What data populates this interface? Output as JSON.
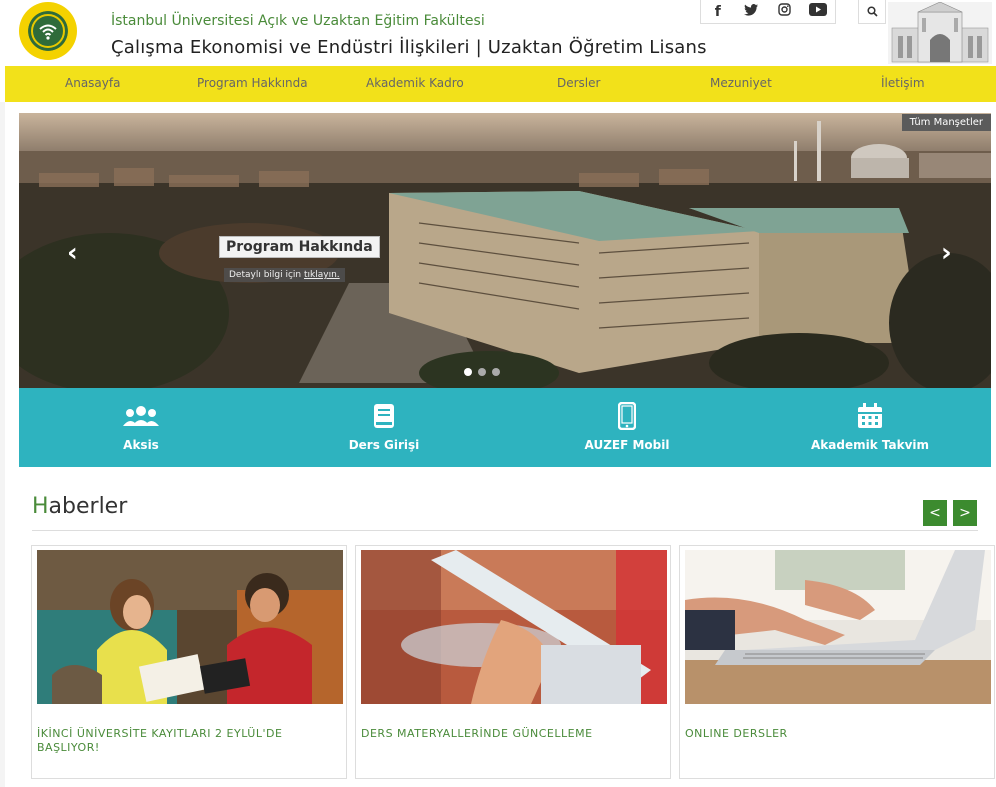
{
  "header": {
    "faculty": "İstanbul Üniversitesi Açık ve Uzaktan Eğitim Fakültesi",
    "program": "Çalışma Ekonomisi ve Endüstri İlişkileri | Uzaktan Öğretim Lisans",
    "socials": [
      {
        "icon": "facebook-icon",
        "glyph": "f"
      },
      {
        "icon": "twitter-icon",
        "glyph": "🐦"
      },
      {
        "icon": "instagram-icon",
        "glyph": "◎"
      },
      {
        "icon": "youtube-icon",
        "glyph": "▶"
      }
    ],
    "search_glyph": "🔍"
  },
  "nav": {
    "items": [
      "Anasayfa",
      "Program Hakkında",
      "Akademik Kadro",
      "Dersler",
      "Mezuniyet",
      "İletişim"
    ]
  },
  "hero": {
    "all_headlines": "Tüm Manşetler",
    "caption_title": "Program Hakkında",
    "caption_sub_prefix": "Detaylı bilgi için",
    "caption_sub_link": "tıklayın.",
    "prev": "‹",
    "next": "›",
    "slide_count": 3,
    "active_slide": 1
  },
  "quick_links": [
    {
      "label": "Aksis",
      "icon": "users-icon"
    },
    {
      "label": "Ders Girişi",
      "icon": "book-icon"
    },
    {
      "label": "AUZEF Mobil",
      "icon": "mobile-icon"
    },
    {
      "label": "Akademik Takvim",
      "icon": "calendar-icon"
    }
  ],
  "news": {
    "title_first": "H",
    "title_rest": "aberler",
    "prev": "<",
    "next": ">",
    "items": [
      {
        "title": "İKİNCİ ÜNİVERSİTE KAYITLARI 2 EYLÜL'DE BAŞLIYOR!"
      },
      {
        "title": "DERS MATERYALLERİNDE GÜNCELLEME"
      },
      {
        "title": "ONLINE DERSLER"
      }
    ]
  },
  "colors": {
    "nav_yellow": "#f2e11a",
    "quick_teal": "#2eb3bf",
    "accent_green": "#4a8b3a",
    "nav_btn_green": "#3c8b2f"
  }
}
